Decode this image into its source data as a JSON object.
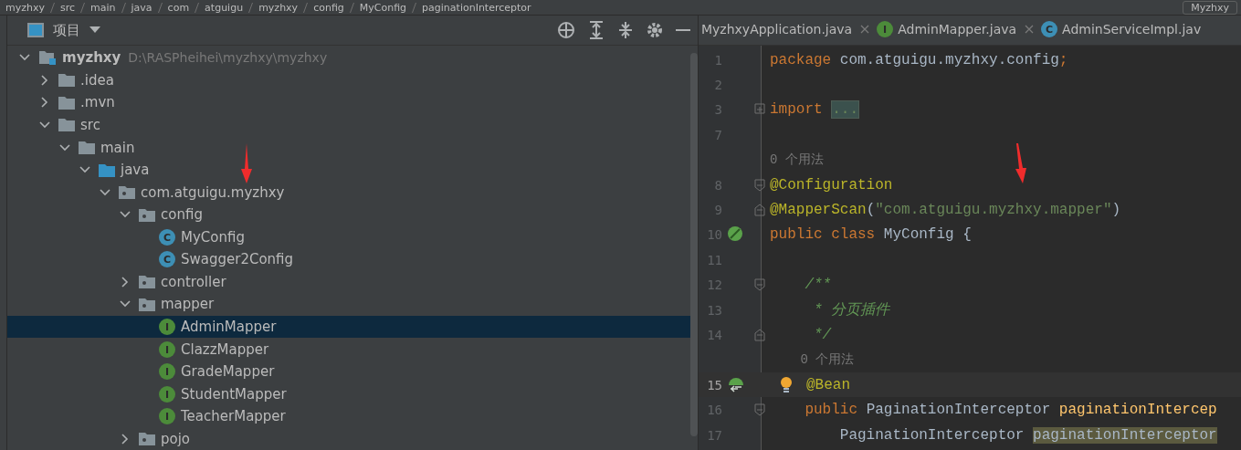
{
  "breadcrumb": [
    "myzhxy",
    "src",
    "main",
    "java",
    "com",
    "atguigu",
    "myzhxy",
    "config",
    "MyConfig",
    "paginationInterceptor"
  ],
  "run_config": "Myzhxy",
  "project_panel": {
    "title": "项目",
    "tree": [
      {
        "name": "myzhxy",
        "kind": "module",
        "path": "D:\\RASPheihei\\myzhxy\\myzhxy",
        "expanded": true,
        "selected": false,
        "children": [
          {
            "name": ".idea",
            "kind": "folder",
            "expanded": false,
            "selected": false
          },
          {
            "name": ".mvn",
            "kind": "folder",
            "expanded": false,
            "selected": false
          },
          {
            "name": "src",
            "kind": "folder",
            "expanded": true,
            "selected": false,
            "children": [
              {
                "name": "main",
                "kind": "folder",
                "expanded": true,
                "selected": false,
                "children": [
                  {
                    "name": "java",
                    "kind": "source",
                    "expanded": true,
                    "selected": false,
                    "children": [
                      {
                        "name": "com.atguigu.myzhxy",
                        "kind": "package",
                        "expanded": true,
                        "selected": false,
                        "children": [
                          {
                            "name": "config",
                            "kind": "package",
                            "expanded": true,
                            "selected": false,
                            "children": [
                              {
                                "name": "MyConfig",
                                "kind": "class",
                                "badge": "C",
                                "selected": false
                              },
                              {
                                "name": "Swagger2Config",
                                "kind": "class",
                                "badge": "C",
                                "selected": false
                              }
                            ]
                          },
                          {
                            "name": "controller",
                            "kind": "package",
                            "expanded": false,
                            "selected": false
                          },
                          {
                            "name": "mapper",
                            "kind": "package",
                            "expanded": true,
                            "selected": false,
                            "children": [
                              {
                                "name": "AdminMapper",
                                "kind": "interface",
                                "badge": "I",
                                "selected": true
                              },
                              {
                                "name": "ClazzMapper",
                                "kind": "interface",
                                "badge": "I",
                                "selected": false
                              },
                              {
                                "name": "GradeMapper",
                                "kind": "interface",
                                "badge": "I",
                                "selected": false
                              },
                              {
                                "name": "StudentMapper",
                                "kind": "interface",
                                "badge": "I",
                                "selected": false
                              },
                              {
                                "name": "TeacherMapper",
                                "kind": "interface",
                                "badge": "I",
                                "selected": false
                              }
                            ]
                          },
                          {
                            "name": "pojo",
                            "kind": "package",
                            "expanded": false,
                            "selected": false
                          }
                        ]
                      }
                    ]
                  }
                ]
              }
            ]
          }
        ]
      }
    ]
  },
  "editor": {
    "tabs": [
      {
        "label": "MyzhxyApplication.java",
        "selected": false
      },
      {
        "label": "AdminMapper.java",
        "kind": "interface",
        "badge": "I",
        "selected": false
      },
      {
        "label": "AdminServiceImpl.jav",
        "kind": "class",
        "badge": "C",
        "selected": false
      }
    ],
    "lines": [
      {
        "number": "1",
        "tokens": [
          {
            "text": "package ",
            "kind": "keyword"
          },
          {
            "text": "com.atguigu.myzhxy.config",
            "kind": "plain"
          },
          {
            "text": ";",
            "kind": "keyword"
          }
        ]
      },
      {
        "number": "2"
      },
      {
        "number": "3",
        "collapsed": true,
        "tokens": [
          {
            "text": "import ",
            "kind": "keyword"
          },
          {
            "text": "...",
            "kind": "folded"
          }
        ]
      },
      {
        "number": "7"
      },
      {
        "kind": "hint",
        "text": "0 个用法"
      },
      {
        "number": "8",
        "fold_open": true,
        "tokens": [
          {
            "text": "@Configuration",
            "kind": "annotation"
          }
        ]
      },
      {
        "number": "9",
        "fold_close": true,
        "tokens": [
          {
            "text": "@MapperScan",
            "kind": "annotation"
          },
          {
            "text": "(",
            "kind": "plain"
          },
          {
            "text": "\"com.atguigu.myzhxy.mapper\"",
            "kind": "string"
          },
          {
            "text": ")",
            "kind": "plain"
          }
        ]
      },
      {
        "number": "10",
        "bean": true,
        "tokens": [
          {
            "text": "public class ",
            "kind": "keyword"
          },
          {
            "text": "MyConfig {",
            "kind": "plain"
          }
        ]
      },
      {
        "number": "11"
      },
      {
        "number": "12",
        "fold_open": true,
        "tokens": [
          {
            "text": "    /**",
            "kind": "comment"
          }
        ]
      },
      {
        "number": "13",
        "tokens": [
          {
            "text": "     * 分页插件",
            "kind": "comment"
          }
        ]
      },
      {
        "number": "14",
        "fold_close": true,
        "tokens": [
          {
            "text": "     */",
            "kind": "comment"
          }
        ]
      },
      {
        "kind": "hint",
        "text": "    0 个用法"
      },
      {
        "number": "15",
        "bean_link": true,
        "current": true,
        "tokens": [
          {
            "text": "@Bean",
            "kind": "annotation"
          }
        ]
      },
      {
        "number": "16",
        "fold_open": true,
        "tokens": [
          {
            "text": "    public ",
            "kind": "keyword"
          },
          {
            "text": "PaginationInterceptor ",
            "kind": "plain"
          },
          {
            "text": "paginationIntercep",
            "kind": "method"
          }
        ]
      },
      {
        "number": "17",
        "tokens": [
          {
            "text": "        PaginationInterceptor ",
            "kind": "plain"
          },
          {
            "text": "paginationInterceptor",
            "kind": "highlight"
          }
        ]
      }
    ]
  }
}
